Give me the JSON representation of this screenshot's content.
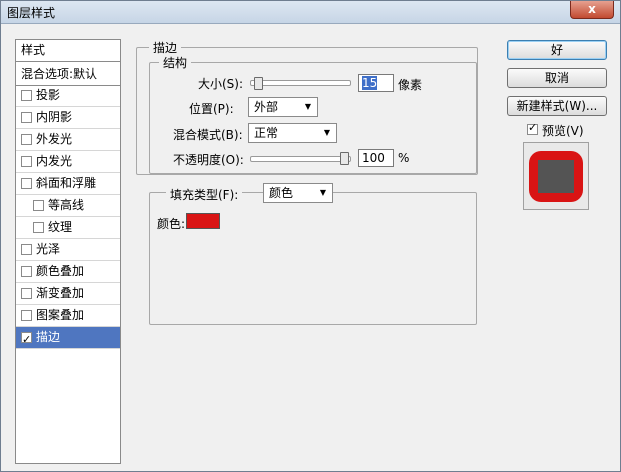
{
  "window": {
    "title": "图层样式",
    "close_label": "x"
  },
  "style_list": {
    "header": "样式",
    "blend": "混合选项:默认",
    "items": [
      {
        "label": "投影",
        "checked": false,
        "sub": false
      },
      {
        "label": "内阴影",
        "checked": false,
        "sub": false
      },
      {
        "label": "外发光",
        "checked": false,
        "sub": false
      },
      {
        "label": "内发光",
        "checked": false,
        "sub": false
      },
      {
        "label": "斜面和浮雕",
        "checked": false,
        "sub": false
      },
      {
        "label": "等高线",
        "checked": false,
        "sub": true
      },
      {
        "label": "纹理",
        "checked": false,
        "sub": true
      },
      {
        "label": "光泽",
        "checked": false,
        "sub": false
      },
      {
        "label": "颜色叠加",
        "checked": false,
        "sub": false
      },
      {
        "label": "渐变叠加",
        "checked": false,
        "sub": false
      },
      {
        "label": "图案叠加",
        "checked": false,
        "sub": false
      },
      {
        "label": "描边",
        "checked": true,
        "sub": false,
        "selected": true
      }
    ]
  },
  "stroke": {
    "title": "描边",
    "structure": {
      "title": "结构",
      "size_label": "大小(S):",
      "size_value": "15",
      "size_unit": "像素",
      "size_level": 0.03,
      "position_label": "位置(P):",
      "position_value": "外部",
      "blend_label": "混合模式(B):",
      "blend_value": "正常",
      "opacity_label": "不透明度(O):",
      "opacity_value": "100",
      "opacity_unit": "%",
      "opacity_level": 1.0
    },
    "fill": {
      "type_label": "填充类型(F):",
      "type_value": "颜色",
      "color_label": "颜色:",
      "color": "#d91414"
    }
  },
  "buttons": {
    "ok": "好",
    "cancel": "取消",
    "new_style": "新建样式(W)...",
    "preview_label": "预览(V)",
    "preview_checked": true
  },
  "preview": {
    "stroke_color": "#d91414",
    "fill_color": "#545454"
  }
}
